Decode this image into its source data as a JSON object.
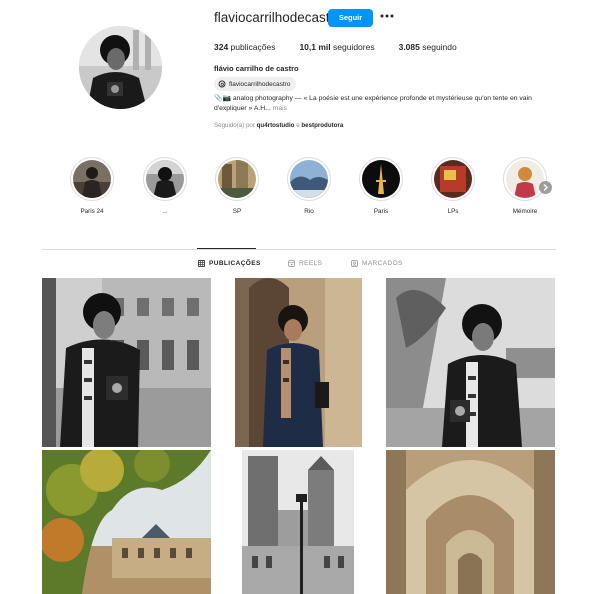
{
  "profile": {
    "username": "flaviocarrilhodecastro",
    "follow_label": "Seguir",
    "more_icon": "ellipsis-icon",
    "stats": {
      "posts_count": "324",
      "posts_label": " publicações",
      "followers_count": "10,1 mil",
      "followers_label": " seguidores",
      "following_count": "3.085",
      "following_label": " seguindo"
    },
    "full_name": "flávio carrilho de castro",
    "threads_handle": "flaviocarrilhodecastro",
    "bio_text": "📎📷 analog photography — « La poésie est une expérience profonde et mystérieuse qu'on tente en vain d'expliquer » A.H...",
    "bio_more": " mais",
    "followed_by_prefix": "Seguido(a) por ",
    "followed_by_user1": "qu4rtostudio",
    "followed_by_sep": " e ",
    "followed_by_user2": "bestprodutora"
  },
  "highlights": [
    {
      "label": "Paris 24"
    },
    {
      "label": "..."
    },
    {
      "label": "SP"
    },
    {
      "label": "Rio"
    },
    {
      "label": "Paris"
    },
    {
      "label": "LPs"
    },
    {
      "label": "Mémoire"
    }
  ],
  "tabs": {
    "posts": "PUBLICAÇÕES",
    "reels": "REELS",
    "tagged": "MARCADOS"
  },
  "colors": {
    "accent": "#0095f6",
    "text": "#262626",
    "muted": "#8e8e8e",
    "border": "#dbdbdb"
  }
}
